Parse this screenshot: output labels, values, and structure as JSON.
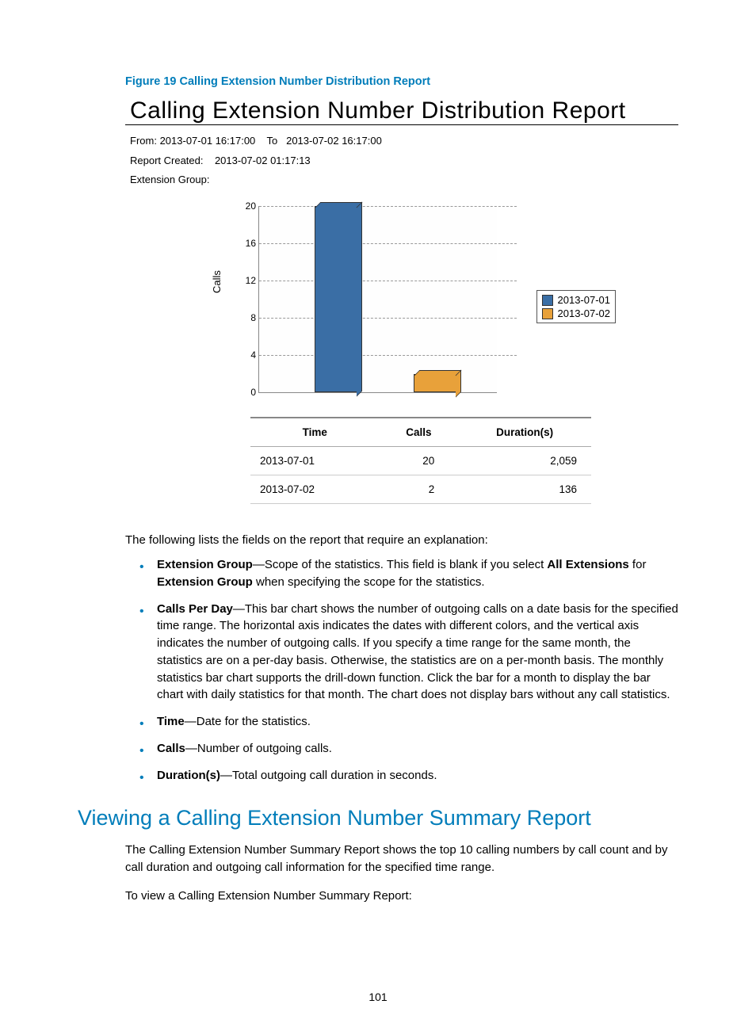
{
  "figure_caption": "Figure 19 Calling Extension Number Distribution Report",
  "report": {
    "title": "Calling Extension Number Distribution Report",
    "from_label": "From:",
    "from_value": "2013-07-01 16:17:00",
    "to_label": "To",
    "to_value": "2013-07-02 16:17:00",
    "created_label": "Report  Created:",
    "created_value": "2013-07-02 01:17:13",
    "ext_group_label": "Extension Group:",
    "ext_group_value": ""
  },
  "chart_data": {
    "type": "bar",
    "ylabel": "Calls",
    "ylim": [
      0,
      20
    ],
    "yticks": [
      0,
      4,
      8,
      12,
      16,
      20
    ],
    "series": [
      {
        "name": "2013-07-01",
        "value": 20,
        "color": "#3a6ea5"
      },
      {
        "name": "2013-07-02",
        "value": 2,
        "color": "#e8a13a"
      }
    ]
  },
  "table": {
    "headers": [
      "Time",
      "Calls",
      "Duration(s)"
    ],
    "rows": [
      [
        "2013-07-01",
        "20",
        "2,059"
      ],
      [
        "2013-07-02",
        "2",
        "136"
      ]
    ]
  },
  "intro_text": "The following lists the fields on the report that require an explanation:",
  "bullets": [
    {
      "term": "Extension Group",
      "desc": "—Scope of the statistics. This field is blank if you select ",
      "bold2": "All Extensions",
      "desc2": " for ",
      "bold3": "Extension Group",
      "desc3": " when specifying the scope for the statistics."
    },
    {
      "term": "Calls Per Day",
      "desc": "—This bar chart shows the number of outgoing calls on a date basis for the specified time range. The horizontal axis indicates the dates with different colors, and the vertical axis indicates the number of outgoing calls. If you specify a time range for the same month, the statistics are on a per-day basis. Otherwise, the statistics are on a per-month basis. The monthly statistics bar chart supports the drill-down function. Click the bar for a month to display the bar chart with daily statistics for that month. The chart does not display bars without any call statistics."
    },
    {
      "term": "Time",
      "desc": "—Date for the statistics."
    },
    {
      "term": "Calls",
      "desc": "—Number of outgoing calls."
    },
    {
      "term": "Duration(s)",
      "desc": "—Total outgoing call duration in seconds."
    }
  ],
  "section_heading": "Viewing a Calling Extension Number Summary Report",
  "section_p1": "The Calling Extension Number Summary Report shows the top 10 calling numbers by call count and by call duration and outgoing call information for the specified time range.",
  "section_p2": "To view a Calling Extension Number Summary Report:",
  "page_number": "101"
}
